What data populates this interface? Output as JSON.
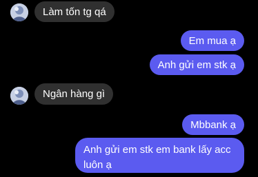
{
  "colors": {
    "background": "#000000",
    "incoming_bubble": "#303030",
    "outgoing_bubble": "#5b5bf0",
    "text": "#ffffff"
  },
  "messages": [
    {
      "direction": "incoming",
      "text": "Làm tốn tg qá",
      "avatar": true
    },
    {
      "direction": "outgoing",
      "text": "Em mua ạ"
    },
    {
      "direction": "outgoing",
      "text": "Anh gửi em stk ạ"
    },
    {
      "direction": "incoming",
      "text": "Ngân hàng gì",
      "avatar": true
    },
    {
      "direction": "outgoing",
      "text": "Mbbank ạ"
    },
    {
      "direction": "outgoing",
      "text": "Anh gửi em stk em bank lấy acc luôn ạ"
    }
  ]
}
